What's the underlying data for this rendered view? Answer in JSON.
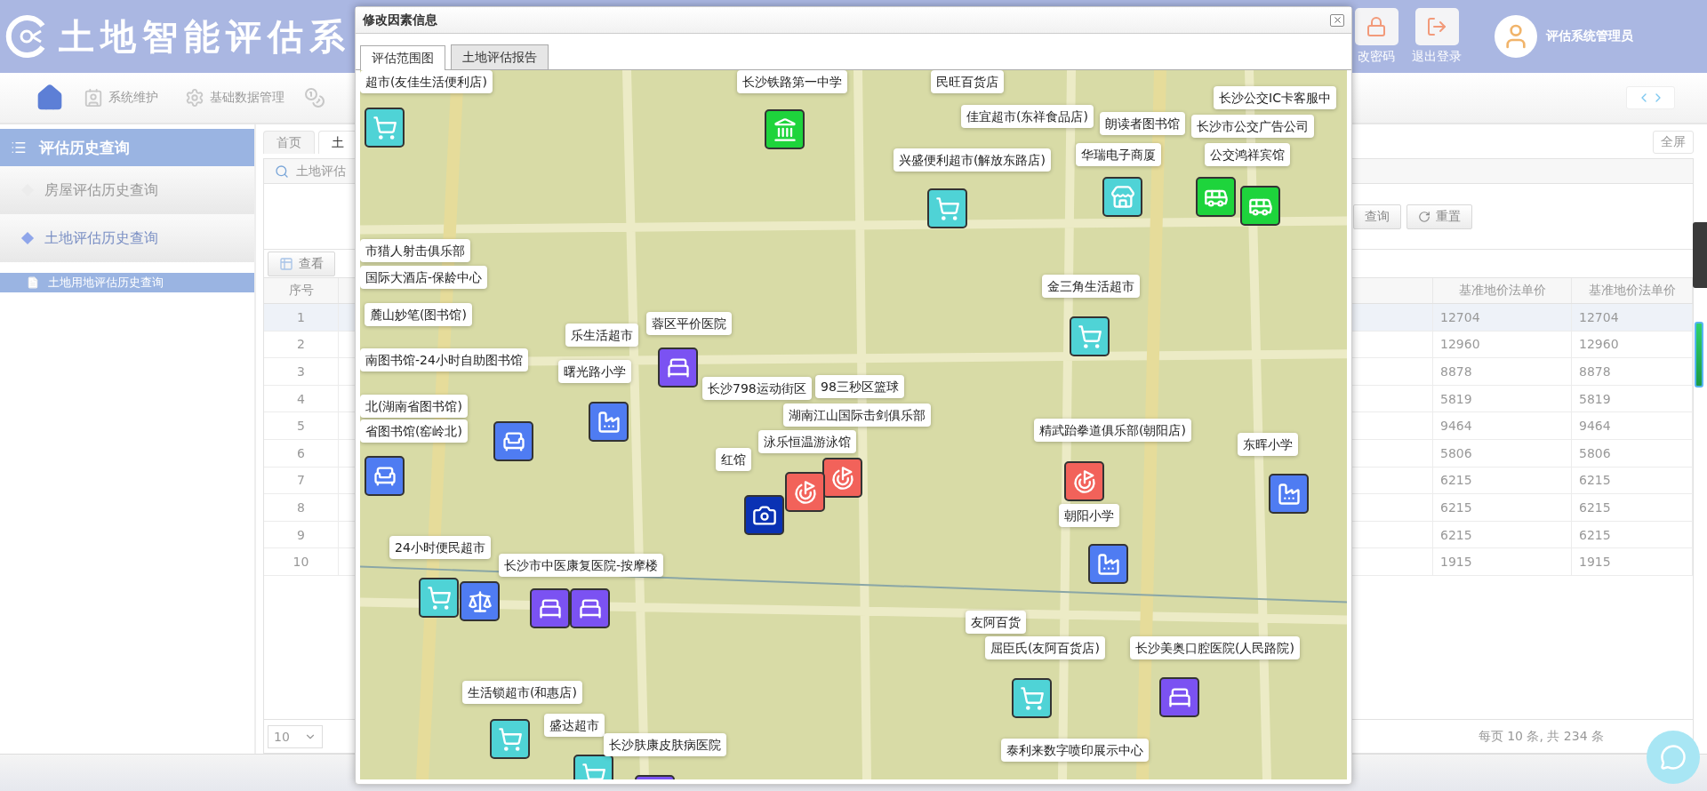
{
  "header": {
    "title": "土地智能评估系",
    "actions": [
      {
        "label": "改密码",
        "kind": "lock"
      },
      {
        "label": "退出登录",
        "kind": "logout"
      }
    ],
    "user": "评估系统管理员"
  },
  "nav": {
    "items": [
      {
        "label": "系统维护",
        "kind": "card"
      },
      {
        "label": "基础数据管理",
        "kind": "gear"
      },
      {
        "kind": "coins"
      }
    ]
  },
  "sidebar": {
    "title": "评估历史查询",
    "items": [
      {
        "label": "房屋评估历史查询",
        "selected": false
      },
      {
        "label": "土地评估历史查询",
        "selected": true,
        "children": [
          {
            "label": "土地用地评估历史查询",
            "selected": true
          }
        ]
      }
    ]
  },
  "tabs": [
    {
      "label": "首页",
      "selected": false
    },
    {
      "label": "土",
      "selected": true
    }
  ],
  "fullscreen_button": "全屏",
  "search_panel": {
    "title": "土地评估",
    "buttons": [
      "查询",
      "重置"
    ]
  },
  "toolbar": {
    "buttons": [
      "查看"
    ]
  },
  "table": {
    "columns": [
      "序号",
      "基准地价法单价",
      "基准地价法单价"
    ],
    "rows": [
      {
        "cells": [
          "1",
          "12704",
          "12704"
        ],
        "selected": true
      },
      {
        "cells": [
          "2",
          "12960",
          "12960"
        ],
        "selected": false
      },
      {
        "cells": [
          "3",
          "8878",
          "8878"
        ],
        "selected": false
      },
      {
        "cells": [
          "4",
          "5819",
          "5819"
        ],
        "selected": false
      },
      {
        "cells": [
          "5",
          "9464",
          "9464"
        ],
        "selected": false
      },
      {
        "cells": [
          "6",
          "5806",
          "5806"
        ],
        "selected": false
      },
      {
        "cells": [
          "7",
          "6215",
          "6215"
        ],
        "selected": false
      },
      {
        "cells": [
          "8",
          "6215",
          "6215"
        ],
        "selected": false
      },
      {
        "cells": [
          "9",
          "6215",
          "6215"
        ],
        "selected": false
      },
      {
        "cells": [
          "10",
          "1915",
          "1915"
        ],
        "selected": false
      }
    ]
  },
  "pagination": {
    "page_size": "10",
    "summary": "每页 10 条, 共 234 条"
  },
  "dialog": {
    "title": "修改因素信息",
    "tabs": [
      {
        "label": "评估范围图",
        "selected": true
      },
      {
        "label": "土地评估报告",
        "selected": false
      }
    ],
    "map": {
      "markers": [
        {
          "label": "超市(友佳生活便利店)",
          "kind": "shop"
        },
        {
          "label": "长沙铁路第一中学",
          "kind": "gate"
        },
        {
          "label": "民旺百货店",
          "kind": "label"
        },
        {
          "label": "佳宜超市(东祥食品店)",
          "kind": "label"
        },
        {
          "label": "朗读者图书馆",
          "kind": "label"
        },
        {
          "label": "华瑞电子商厦",
          "kind": "market"
        },
        {
          "label": "兴盛便利超市(解放东路店)",
          "kind": "shop"
        },
        {
          "label": "长沙公交IC卡客服中",
          "kind": "label"
        },
        {
          "label": "长沙市公交广告公司",
          "kind": "bus"
        },
        {
          "label": "公交鸿祥宾馆",
          "kind": "bus"
        },
        {
          "label": "金三角生活超市",
          "kind": "shop"
        },
        {
          "label": "精武跆拳道俱乐部(朝阳店)",
          "kind": "sports"
        },
        {
          "label": "东晖小学",
          "kind": "school"
        },
        {
          "label": "朝阳小学",
          "kind": "school"
        },
        {
          "label": "友阿百货",
          "kind": "label"
        },
        {
          "label": "屈臣氏(友阿百货店)",
          "kind": "shop"
        },
        {
          "label": "长沙美奥口腔医院(人民路院)",
          "kind": "hospital"
        },
        {
          "label": "泰利来数字喷印展示中心",
          "kind": "label"
        },
        {
          "label": "市猎人射击俱乐部",
          "kind": "label"
        },
        {
          "label": "国际大酒店-保龄中心",
          "kind": "label"
        },
        {
          "label": "麓山妙笔(图书馆)",
          "kind": "label"
        },
        {
          "label": "乐生活超市",
          "kind": "label"
        },
        {
          "label": "蓉区平价医院",
          "kind": "hospital"
        },
        {
          "label": "南图书馆-24小时自助图书馆",
          "kind": "label"
        },
        {
          "label": "曙光路小学",
          "kind": "school"
        },
        {
          "label": "长沙798运动街区",
          "kind": "label"
        },
        {
          "label": "98三秒区篮球",
          "kind": "label"
        },
        {
          "label": "湖南江山国际击剑俱乐部",
          "kind": "label"
        },
        {
          "label": "泳乐恒温游泳馆",
          "kind": "sports"
        },
        {
          "label": "红馆",
          "kind": "sports"
        },
        {
          "kind": "camera"
        },
        {
          "label": "北(湖南省图书馆)",
          "kind": "label"
        },
        {
          "label": "省图书馆(窑岭北)",
          "kind": "library"
        },
        {
          "kind": "library"
        },
        {
          "label": "24小时便民超市",
          "kind": "shop"
        },
        {
          "kind": "law"
        },
        {
          "label": "长沙市中医康复医院-按摩楼",
          "kind": "hospital"
        },
        {
          "kind": "hospital"
        },
        {
          "label": "生活锁超市(和惠店)",
          "kind": "shop"
        },
        {
          "label": "盛达超市",
          "kind": "shop"
        },
        {
          "label": "长沙肤康皮肤病医院",
          "kind": "hospital"
        }
      ]
    }
  }
}
